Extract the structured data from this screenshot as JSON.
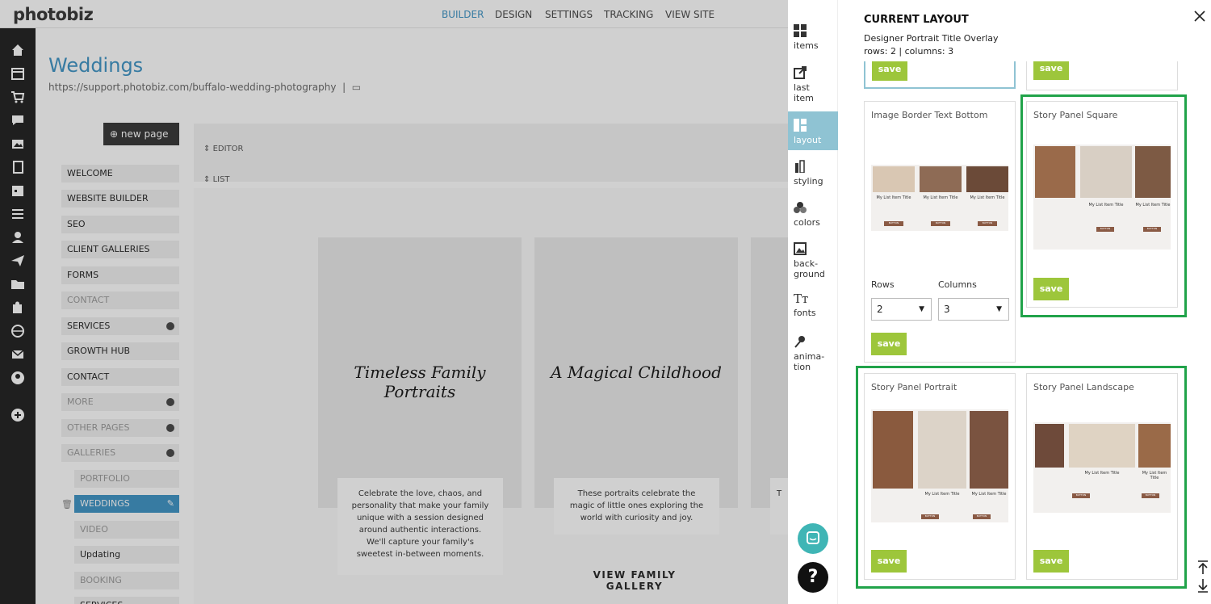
{
  "topbar": {
    "logo": "photobiz",
    "nav": [
      {
        "label": "BUILDER",
        "color": "#3c92c4"
      },
      {
        "label": "DESIGN"
      },
      {
        "label": "SETTINGS"
      },
      {
        "label": "TRACKING"
      },
      {
        "label": "VIEW SITE"
      }
    ]
  },
  "page": {
    "title": "Weddings",
    "url": "https://support.photobiz.com/buffalo-wedding-photography",
    "new_page_label": "new page",
    "editor_label": "EDITOR",
    "list_label": "LIST"
  },
  "menu": [
    {
      "label": "WELCOME"
    },
    {
      "label": "WEBSITE BUILDER"
    },
    {
      "label": "SEO"
    },
    {
      "label": "CLIENT GALLERIES"
    },
    {
      "label": "FORMS"
    },
    {
      "label": "CONTACT"
    },
    {
      "label": "SERVICES"
    },
    {
      "label": "GROWTH HUB"
    },
    {
      "label": "CONTACT"
    },
    {
      "label": "MORE"
    },
    {
      "label": "OTHER PAGES"
    },
    {
      "label": "GALLERIES"
    },
    {
      "label": "PORTFOLIO"
    },
    {
      "label": "WEDDINGS"
    },
    {
      "label": "VIDEO"
    },
    {
      "label": "Updating"
    },
    {
      "label": "BOOKING"
    },
    {
      "label": "SERVICES"
    }
  ],
  "cards": [
    {
      "title": "Timeless Family Portraits",
      "text": "Celebrate the love, chaos, and personality that make your family unique with a session designed around authentic interactions. We'll capture your family's sweetest in-between moments."
    },
    {
      "title": "A Magical Childhood",
      "text": "These portraits celebrate the magic of little ones exploring the world with curiosity and joy.",
      "link": "VIEW FAMILY GALLERY"
    },
    {
      "text": "T"
    }
  ],
  "sidetabs": [
    {
      "label": "items",
      "icon": "grid-icon"
    },
    {
      "label": "last item",
      "icon": "share-icon"
    },
    {
      "label": "layout",
      "icon": "layout-icon"
    },
    {
      "label": "styling",
      "icon": "brush-icon"
    },
    {
      "label": "colors",
      "icon": "palette-icon"
    },
    {
      "label": "back-ground",
      "icon": "image-icon"
    },
    {
      "label": "fonts",
      "icon": "text-icon"
    },
    {
      "label": "anima-tion",
      "icon": "wand-icon"
    }
  ],
  "layout_panel": {
    "heading": "CURRENT LAYOUT",
    "layout_name": "Designer Portrait Title Overlay",
    "rows_columns": "rows: 2 | columns: 3",
    "save_label": "save",
    "layouts": [
      {
        "name": "Image Border Text Bottom",
        "rows_label": "Rows",
        "columns_label": "Columns",
        "rows": "2",
        "columns": "3"
      },
      {
        "name": "Story Panel Square"
      },
      {
        "name": "Story Panel Portrait"
      },
      {
        "name": "Story Panel Landscape"
      }
    ],
    "thumb_item_title": "My List Item Title",
    "thumb_item_button": "BUTTON"
  },
  "colors": {
    "accent_blue": "#3c92c4",
    "save_green": "#9dc63b",
    "highlight_green": "#21a34a",
    "active_tab": "#8fc3d3"
  }
}
